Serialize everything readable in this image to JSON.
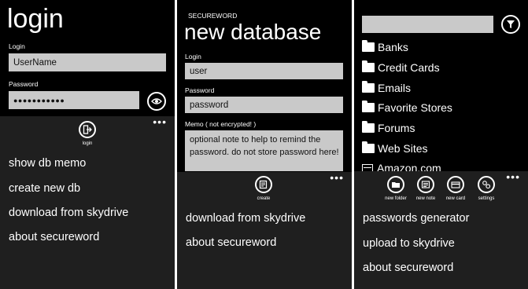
{
  "screen1": {
    "title": "login",
    "login_label": "Login",
    "username_value": "UserName",
    "password_label": "Password",
    "password_value": "●●●●●●●●●●●",
    "eye_icon": "eye-icon",
    "appbar_button_label": "login",
    "more_dots": "•••",
    "menu": [
      "show db memo",
      "create new db",
      "download from skydrive",
      "about secureword"
    ]
  },
  "screen2": {
    "app_name": "SECUREWORD",
    "title": "new database",
    "login_label": "Login",
    "login_value": "user",
    "password_label": "Password",
    "password_value": "password",
    "memo_label": "Memo ( not encrypted! )",
    "memo_value": "optional note to help to remind the password. do not store password here!",
    "appbar_button_label": "create",
    "more_dots": "•••",
    "menu": [
      "download from skydrive",
      "about secureword"
    ]
  },
  "screen3": {
    "search_value": "",
    "folders": [
      "Banks",
      "Credit Cards",
      "Emails",
      "Favorite Stores",
      "Forums",
      "Web Sites"
    ],
    "partial_item": "Amazon.com",
    "appbar_buttons": [
      "new folder",
      "new note",
      "new card",
      "settings"
    ],
    "more_dots": "•••",
    "menu": [
      "passwords generator",
      "upload to skydrive",
      "about secureword"
    ]
  }
}
